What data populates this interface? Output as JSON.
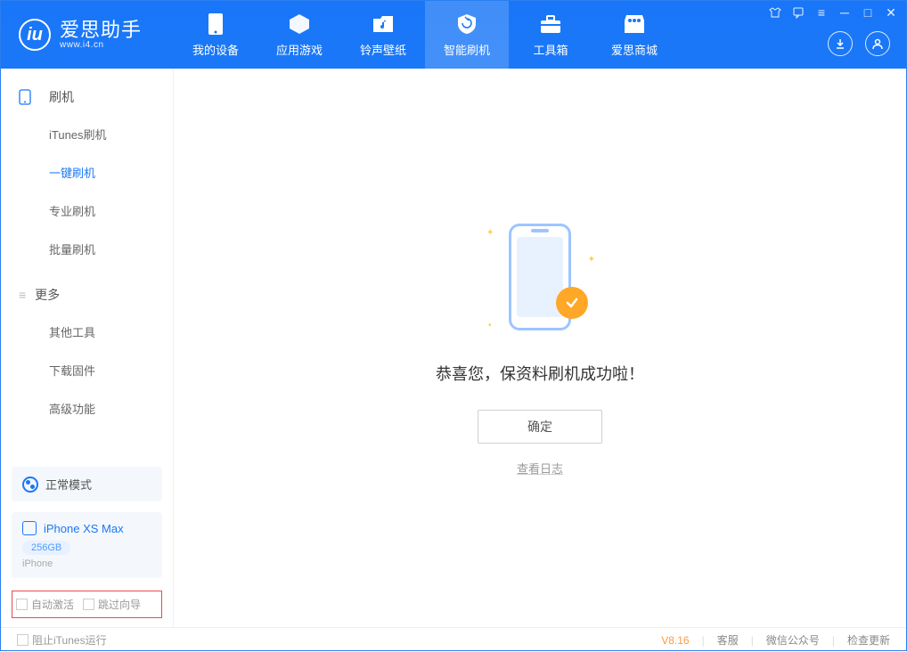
{
  "app": {
    "name": "爱思助手",
    "url": "www.i4.cn"
  },
  "nav": {
    "tabs": [
      {
        "label": "我的设备"
      },
      {
        "label": "应用游戏"
      },
      {
        "label": "铃声壁纸"
      },
      {
        "label": "智能刷机"
      },
      {
        "label": "工具箱"
      },
      {
        "label": "爱思商城"
      }
    ],
    "active_index": 3
  },
  "sidebar": {
    "section_flash": "刷机",
    "section_more": "更多",
    "items_flash": [
      {
        "label": "iTunes刷机"
      },
      {
        "label": "一键刷机"
      },
      {
        "label": "专业刷机"
      },
      {
        "label": "批量刷机"
      }
    ],
    "items_more": [
      {
        "label": "其他工具"
      },
      {
        "label": "下载固件"
      },
      {
        "label": "高级功能"
      }
    ],
    "active_flash_index": 1,
    "mode_label": "正常模式",
    "device": {
      "name": "iPhone XS Max",
      "storage": "256GB",
      "type": "iPhone"
    },
    "auto_activate": "自动激活",
    "skip_guide": "跳过向导"
  },
  "main": {
    "success_text": "恭喜您，保资料刷机成功啦！",
    "ok_label": "确定",
    "log_link": "查看日志"
  },
  "footer": {
    "block_itunes": "阻止iTunes运行",
    "version": "V8.16",
    "links": [
      "客服",
      "微信公众号",
      "检查更新"
    ]
  }
}
